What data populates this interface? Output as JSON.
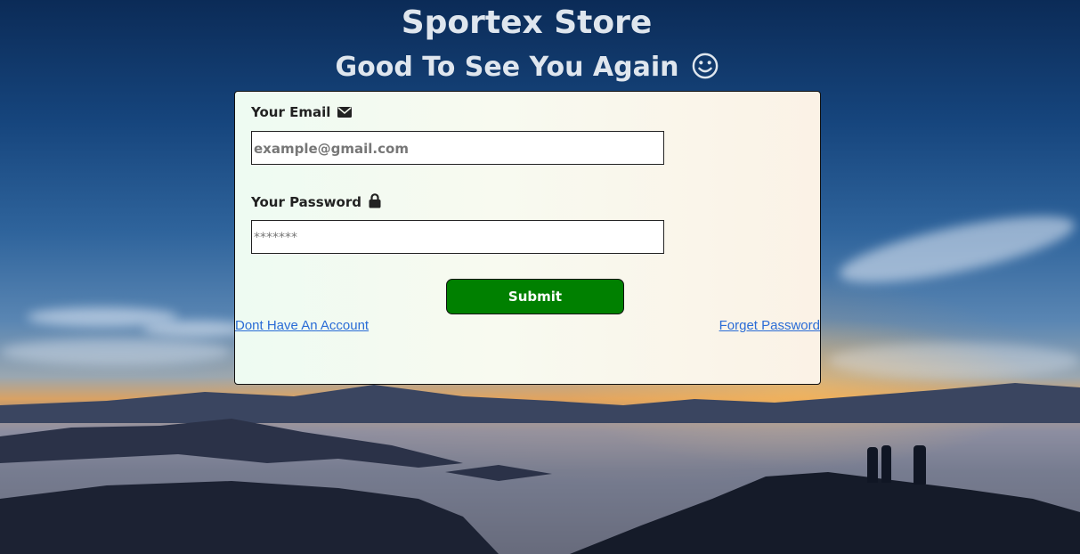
{
  "header": {
    "title": "Sportex Store",
    "subtitle": "Good To See You Again"
  },
  "form": {
    "email_label": "Your Email",
    "email_placeholder": "example@gmail.com",
    "password_label": "Your Password",
    "password_placeholder": "*******",
    "submit_label": "Submit",
    "signup_link": "Dont Have An Account",
    "forgot_link": "Forget Password"
  },
  "icons": {
    "email": "envelope-icon",
    "password": "lock-icon",
    "subtitle": "smiley-icon"
  },
  "colors": {
    "submit_bg": "#008000",
    "link": "#2a6cd6",
    "heading": "#dfe6ee"
  }
}
